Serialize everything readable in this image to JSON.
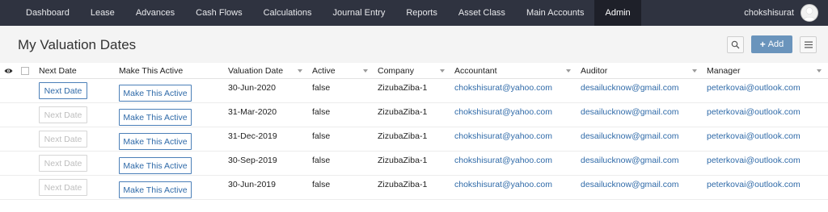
{
  "nav": {
    "items": [
      "Dashboard",
      "Lease",
      "Advances",
      "Cash Flows",
      "Calculations",
      "Journal Entry",
      "Reports",
      "Asset Class",
      "Main Accounts",
      "Admin"
    ],
    "active": "Admin",
    "username": "chokshisurat"
  },
  "page": {
    "title": "My Valuation Dates",
    "add_label": "Add"
  },
  "table": {
    "headers": {
      "next": "Next Date",
      "make": "Make This Active",
      "valuation": "Valuation Date",
      "active": "Active",
      "company": "Company",
      "accountant": "Accountant",
      "auditor": "Auditor",
      "manager": "Manager"
    },
    "rows": [
      {
        "next": "Next Date",
        "next_enabled": true,
        "make": "Make This Active",
        "date": "30-Jun-2020",
        "active": "false",
        "company": "ZizubaZiba-1",
        "accountant": "chokshisurat@yahoo.com",
        "auditor": "desailucknow@gmail.com",
        "manager": "peterkovai@outlook.com"
      },
      {
        "next": "Next Date",
        "next_enabled": false,
        "make": "Make This Active",
        "date": "31-Mar-2020",
        "active": "false",
        "company": "ZizubaZiba-1",
        "accountant": "chokshisurat@yahoo.com",
        "auditor": "desailucknow@gmail.com",
        "manager": "peterkovai@outlook.com"
      },
      {
        "next": "Next Date",
        "next_enabled": false,
        "make": "Make This Active",
        "date": "31-Dec-2019",
        "active": "false",
        "company": "ZizubaZiba-1",
        "accountant": "chokshisurat@yahoo.com",
        "auditor": "desailucknow@gmail.com",
        "manager": "peterkovai@outlook.com"
      },
      {
        "next": "Next Date",
        "next_enabled": false,
        "make": "Make This Active",
        "date": "30-Sep-2019",
        "active": "false",
        "company": "ZizubaZiba-1",
        "accountant": "chokshisurat@yahoo.com",
        "auditor": "desailucknow@gmail.com",
        "manager": "peterkovai@outlook.com"
      },
      {
        "next": "Next Date",
        "next_enabled": false,
        "make": "Make This Active",
        "date": "30-Jun-2019",
        "active": "false",
        "company": "ZizubaZiba-1",
        "accountant": "chokshisurat@yahoo.com",
        "auditor": "desailucknow@gmail.com",
        "manager": "peterkovai@outlook.com"
      }
    ]
  },
  "icons": {
    "eye": "eye-icon",
    "search": "search-icon",
    "menu": "hamburger-menu-icon",
    "avatar": "user-avatar-icon"
  },
  "colors": {
    "nav_bg": "#2f3340",
    "accent": "#6a94bc",
    "link": "#2f6aa8"
  }
}
